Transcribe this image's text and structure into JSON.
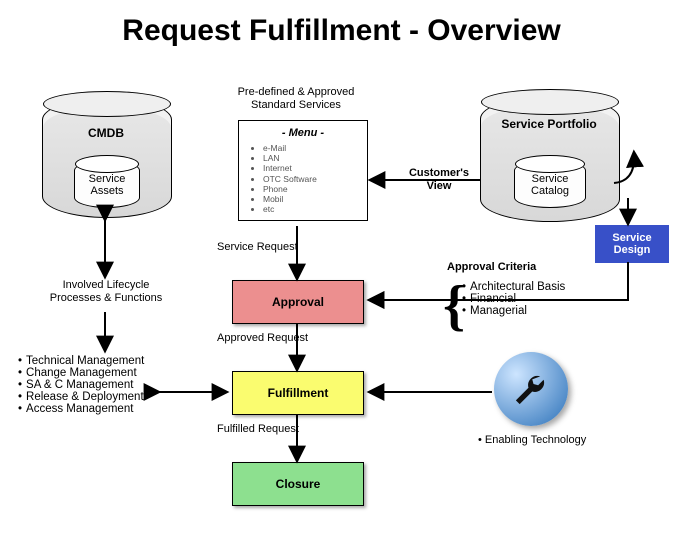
{
  "title": "Request Fulfillment - Overview",
  "cmdb": {
    "label": "CMDB",
    "inner": "Service Assets"
  },
  "portfolio": {
    "label": "Service Portfolio",
    "inner": "Service Catalog"
  },
  "service_design": "Service Design",
  "menu": {
    "header": "Pre-defined & Approved Standard Services",
    "title": "- Menu -",
    "items": [
      "e-Mail",
      "LAN",
      "Internet",
      "OTC Software",
      "Phone",
      "Mobil",
      "etc"
    ]
  },
  "labels": {
    "customers_view": "Customer's View",
    "service_request": "Service Request",
    "approved_request": "Approved Request",
    "fulfilled_request": "Fulfilled Request",
    "approval_criteria_title": "Approval Criteria",
    "involved": "Involved Lifecycle Processes & Functions",
    "enabling_tech": "• Enabling Technology"
  },
  "approval_criteria": [
    "Architectural Basis",
    "Financial",
    "Managerial"
  ],
  "involved_items": [
    "Technical Management",
    "Change Management",
    "SA & C Management",
    "Release & Deployment",
    "Access Management"
  ],
  "process": {
    "approval": "Approval",
    "fulfillment": "Fulfillment",
    "closure": "Closure"
  }
}
